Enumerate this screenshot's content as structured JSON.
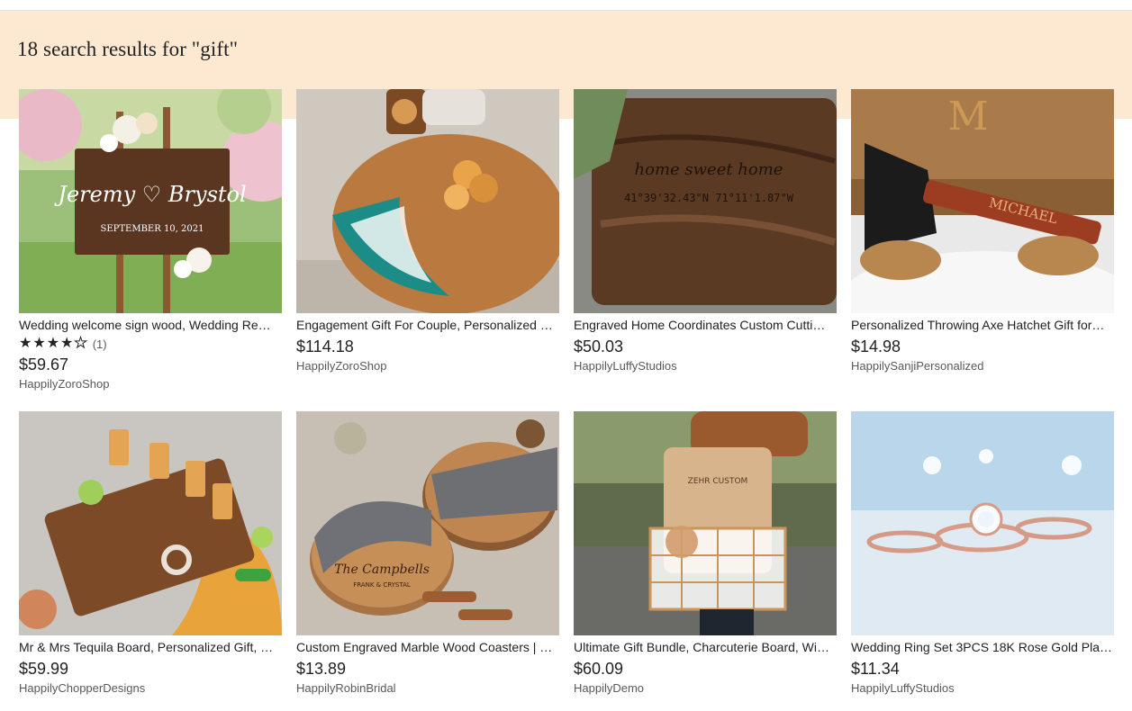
{
  "search": {
    "heading": "18 search results for \"gift\""
  },
  "colors": {
    "banner": "#fde9d2",
    "text": "#222222",
    "muted": "#595959"
  },
  "listings": [
    {
      "title": "Wedding welcome sign wood, Wedding Re…",
      "image_sign_names": "Jeremy ♡ Brystol",
      "image_sign_date": "SEPTEMBER 10, 2021",
      "rating_stars": 4,
      "rating_count": "(1)",
      "price": "$59.67",
      "shop": "HappilyZoroShop"
    },
    {
      "title": "Engagement Gift For Couple, Personalized …",
      "price": "$114.18",
      "shop": "HappilyZoroShop"
    },
    {
      "title": "Engraved Home Coordinates Custom Cutti…",
      "image_coords": "41°39'32.43\"N  71°11'1.87\"W",
      "image_script": "home sweet home",
      "price": "$50.03",
      "shop": "HappilyLuffyStudios"
    },
    {
      "title": "Personalized Throwing Axe Hatchet Gift for…",
      "image_engraving": "MICHAEL",
      "image_monogram": "M",
      "price": "$14.98",
      "shop": "HappilySanjiPersonalized"
    },
    {
      "title": "Mr & Mrs Tequila Board, Personalized Gift, …",
      "price": "$59.99",
      "shop": "HappilyChopperDesigns"
    },
    {
      "title": "Custom Engraved Marble Wood Coasters | …",
      "image_coaster": "The Campbells",
      "image_coaster_names": "FRANK & CRYSTAL",
      "price": "$13.89",
      "shop": "HappilyRobinBridal"
    },
    {
      "title": "Ultimate Gift Bundle, Charcuterie Board, Wi…",
      "image_board": "ZEHR CUSTOM",
      "price": "$60.09",
      "shop": "HappilyDemo"
    },
    {
      "title": "Wedding Ring Set 3PCS 18K Rose Gold Plat…",
      "price": "$11.34",
      "shop": "HappilyLuffyStudios"
    }
  ]
}
